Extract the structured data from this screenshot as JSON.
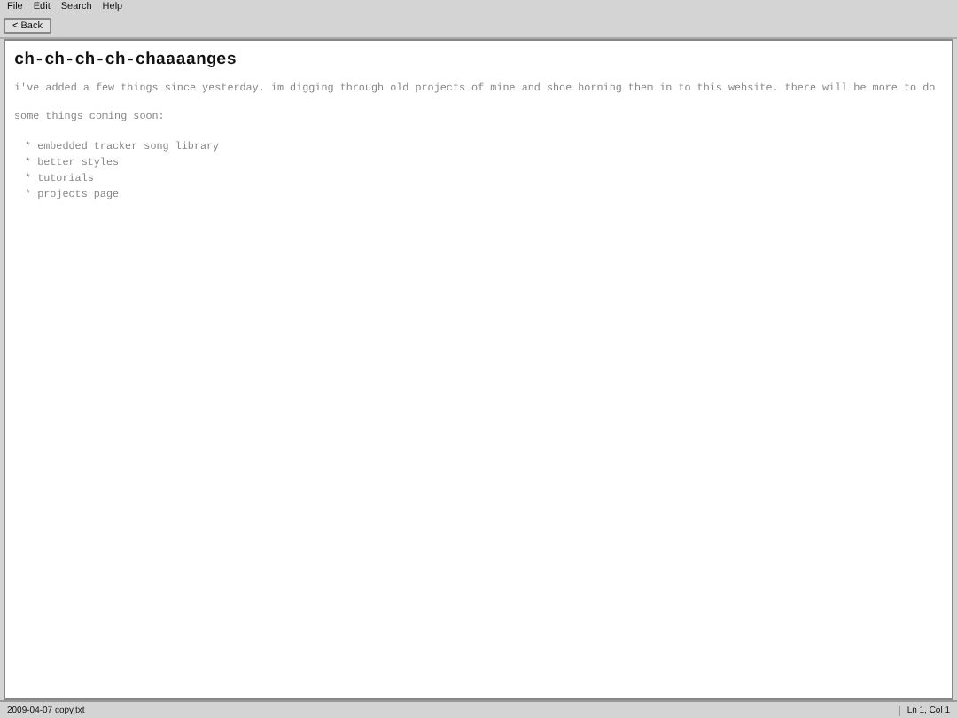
{
  "menu": [
    "File",
    "Edit",
    "Search",
    "Help"
  ],
  "toolbar": {
    "back_button": "< Back"
  },
  "document": {
    "title": "ch-ch-ch-ch-chaaaanges",
    "paragraphs": [
      "i've added a few things since yesterday. im digging through old projects of mine and shoe horning them in to this website. there will be more to do",
      "some things coming soon:"
    ],
    "list": [
      "* embedded tracker song library",
      "* better styles",
      "* tutorials",
      "* projects page"
    ]
  },
  "status_bar": {
    "file": "2009-04-07 copy.txt",
    "position": "Ln 1, Col 1"
  }
}
